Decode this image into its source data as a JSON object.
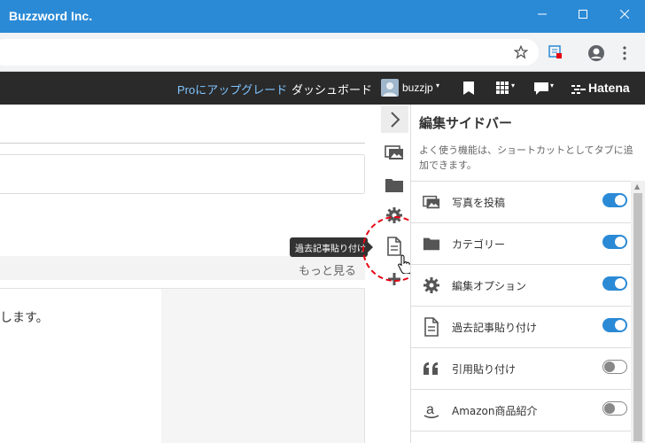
{
  "window": {
    "title": "Buzzword Inc."
  },
  "header": {
    "pro_link": "Proにアップグレード",
    "dashboard": "ダッシュボード",
    "username": "buzzjp",
    "brand": "Hatena"
  },
  "main": {
    "more_link": "もっと見る",
    "content_text": "します。"
  },
  "tooltip": "過去記事貼り付け",
  "sidebar": {
    "title": "編集サイドバー",
    "description": "よく使う機能は、ショートカットとしてタブに追加できます。",
    "items": [
      {
        "label": "写真を投稿",
        "icon": "photo-icon",
        "enabled": true
      },
      {
        "label": "カテゴリー",
        "icon": "folder-icon",
        "enabled": true
      },
      {
        "label": "編集オプション",
        "icon": "gear-icon",
        "enabled": true
      },
      {
        "label": "過去記事貼り付け",
        "icon": "document-icon",
        "enabled": true
      },
      {
        "label": "引用貼り付け",
        "icon": "quote-icon",
        "enabled": false
      },
      {
        "label": "Amazon商品紹介",
        "icon": "amazon-icon",
        "enabled": false
      }
    ]
  },
  "colors": {
    "titlebar": "#2b8ad6",
    "toggle_on": "#2b8ad6",
    "header_bg": "#2a2a2a",
    "highlight_circle": "#e60012"
  }
}
